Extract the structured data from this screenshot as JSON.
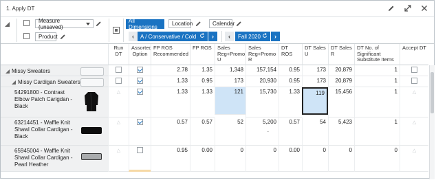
{
  "window": {
    "title": "1. Apply DT"
  },
  "toolbar": {
    "measure_select": "Measure (unsaved)",
    "product_chip": "Product",
    "all_dimensions": "All Dimensions",
    "location_chip": "Location",
    "calendar_chip": "Calendar",
    "location_nav": "A / Conservative / Cold",
    "calendar_nav": "Fall 2020"
  },
  "columns": [
    "Run DT",
    "Assorted Option",
    "FP ROS Recommended",
    "FP ROS",
    "Sales Reg+Promo U",
    "Sales Reg+Promo R",
    "DT ROS",
    "DT Sales U",
    "DT Sales R",
    "DT No. of Significant Substitute Items",
    "Accept DT"
  ],
  "rows": [
    {
      "label": "Missy Sweaters",
      "expanded": true,
      "level": 0,
      "has_image": false,
      "run_dt": "checkbox",
      "assorted": true,
      "fp_ros_rec": "2.78",
      "fp_ros": "1.35",
      "sales_u": "1,348",
      "sales_r": "157,154",
      "dt_ros": "0.95",
      "dt_sales_u": "173",
      "dt_sales_r": "20,879",
      "dt_subs": "1",
      "accept": "checkbox"
    },
    {
      "label": "Missy Cardigan Sweaters",
      "expanded": true,
      "level": 1,
      "has_image": false,
      "run_dt": "checkbox",
      "assorted": true,
      "fp_ros_rec": "1.33",
      "fp_ros": "0.95",
      "sales_u": "173",
      "sales_r": "20,930",
      "dt_ros": "0.95",
      "dt_sales_u": "173",
      "dt_sales_r": "20,879",
      "dt_subs": "1",
      "accept": "checkbox"
    },
    {
      "label": "54291800 - Contrast Elbow Patch Carigdan - Black",
      "level": 2,
      "has_image": true,
      "image": "black-cardigan",
      "run_dt": "triangle",
      "assorted": true,
      "fp_ros_rec": "1.33",
      "fp_ros": "1.33",
      "sales_u": "121",
      "sales_r": "15,730",
      "dt_ros": "1.33",
      "dt_sales_u": "119",
      "dt_sales_r": "15,456",
      "dt_subs": "1",
      "accept": "triangle"
    },
    {
      "label": "63214451 - Waffle Knit Shawl Collar Cardigan - Black",
      "level": 2,
      "has_image": true,
      "image": "black-swatch",
      "run_dt": "triangle",
      "assorted": true,
      "fp_ros_rec": "0.57",
      "fp_ros": "0.57",
      "sales_u": "52",
      "sales_r": "5,200",
      "sales_r_note": ".",
      "dt_ros": "0.57",
      "dt_sales_u": "54",
      "dt_sales_r": "5,423",
      "dt_subs": "1",
      "accept": "triangle"
    },
    {
      "label": "65945004 - Waffle Knit Shawl Collar Cardigan - Pearl Heather",
      "level": 2,
      "has_image": true,
      "image": "grey-swatch",
      "run_dt": "triangle",
      "assorted": false,
      "fp_ros_rec": "0.95",
      "fp_ros": "0.00",
      "sales_u": "0",
      "sales_r": "0",
      "dt_ros": "0.00",
      "dt_sales_u": "0",
      "dt_sales_r": "0",
      "dt_subs": "0",
      "accept": "triangle"
    }
  ],
  "colors": {
    "accent": "#1a73c2",
    "selected_cell": "#cfe4f7",
    "row_header_bg": "#f0f1f2"
  },
  "icons": [
    "pencil-icon",
    "expand-icon",
    "close-icon",
    "refresh-icon",
    "chevron-left-icon",
    "chevron-right-icon",
    "chevron-down-icon"
  ]
}
